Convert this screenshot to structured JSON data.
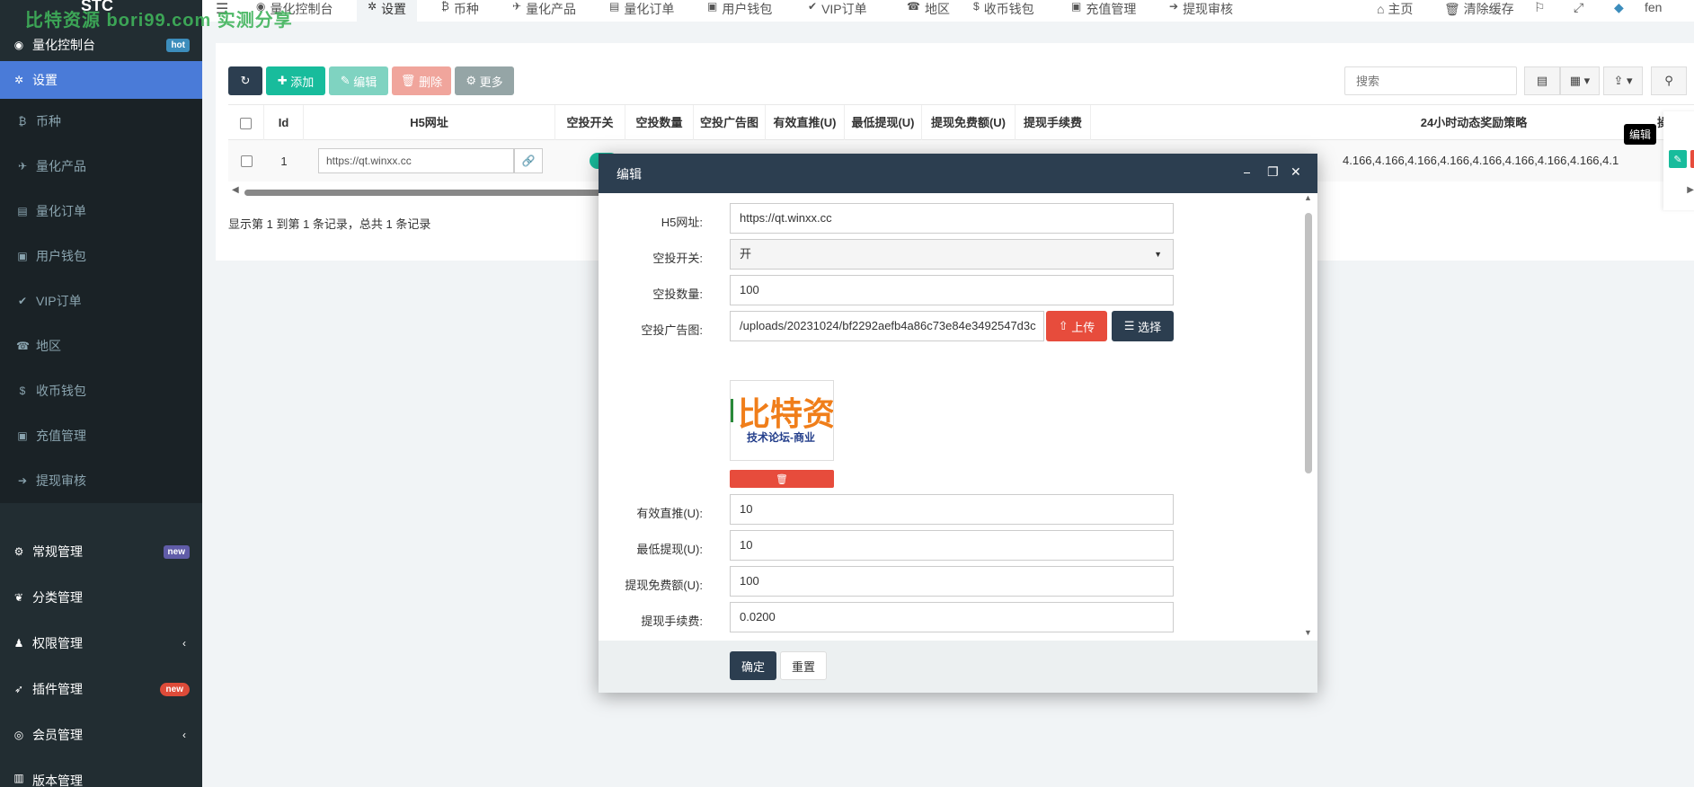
{
  "brand": {
    "name": "STC",
    "watermark": "比特资源  bori99.com  实测分享"
  },
  "sidebar": {
    "items": [
      {
        "label": "量化控制台",
        "icon": "dashboard-icon",
        "glyph": "◉",
        "badge": "hot"
      },
      {
        "label": "设置",
        "icon": "gear-icon",
        "glyph": "✲",
        "active": true
      },
      {
        "label": "币种",
        "icon": "bitcoin-icon",
        "glyph": "₿"
      },
      {
        "label": "量化产品",
        "icon": "plane-icon",
        "glyph": "✈"
      },
      {
        "label": "量化订单",
        "icon": "book-icon",
        "glyph": "▤"
      },
      {
        "label": "用户钱包",
        "icon": "money-icon",
        "glyph": "▣"
      },
      {
        "label": "VIP订单",
        "icon": "check-circle-icon",
        "glyph": "✔"
      },
      {
        "label": "地区",
        "icon": "phone-square-icon",
        "glyph": "☎"
      },
      {
        "label": "收币钱包",
        "icon": "dollar-icon",
        "glyph": "$"
      },
      {
        "label": "充值管理",
        "icon": "money-icon",
        "glyph": "▣"
      },
      {
        "label": "提现审核",
        "icon": "arrow-circle-icon",
        "glyph": "➔"
      },
      {
        "label": "常规管理",
        "icon": "cogs-icon",
        "glyph": "⚙",
        "badge": "new"
      },
      {
        "label": "分类管理",
        "icon": "leaf-icon",
        "glyph": "❦"
      },
      {
        "label": "权限管理",
        "icon": "group-icon",
        "glyph": "♟"
      },
      {
        "label": "插件管理",
        "icon": "rocket-icon",
        "glyph": "➶",
        "badge": "new"
      },
      {
        "label": "会员管理",
        "icon": "user-circle-icon",
        "glyph": "◎"
      },
      {
        "label": "版本管理",
        "icon": "file-icon",
        "glyph": "▥"
      }
    ]
  },
  "topbar": {
    "tabs": [
      {
        "label": "量化控制台",
        "icon": "dashboard-icon",
        "glyph": "◉"
      },
      {
        "label": "设置",
        "icon": "gear-icon",
        "glyph": "✲",
        "active": true
      },
      {
        "label": "币种",
        "icon": "bitcoin-icon",
        "glyph": "₿"
      },
      {
        "label": "量化产品",
        "icon": "plane-icon",
        "glyph": "✈"
      },
      {
        "label": "量化订单",
        "icon": "book-icon",
        "glyph": "▤"
      },
      {
        "label": "用户钱包",
        "icon": "money-icon",
        "glyph": "▣"
      },
      {
        "label": "VIP订单",
        "icon": "check-circle-icon",
        "glyph": "✔"
      },
      {
        "label": "地区",
        "icon": "phone-square-icon",
        "glyph": "☎"
      },
      {
        "label": "收币钱包",
        "icon": "dollar-icon",
        "glyph": "$"
      },
      {
        "label": "充值管理",
        "icon": "money-icon",
        "glyph": "▣"
      },
      {
        "label": "提现审核",
        "icon": "arrow-circle-icon",
        "glyph": "➔"
      }
    ],
    "home": "主页",
    "clear_cache": "清除缓存",
    "username": "fen"
  },
  "toolbar": {
    "add": "添加",
    "edit": "编辑",
    "delete": "删除",
    "more": "更多",
    "search_placeholder": "搜索"
  },
  "table": {
    "headers": [
      "Id",
      "H5网址",
      "空投开关",
      "空投数量",
      "空投广告图",
      "有效直推(U)",
      "最低提现(U)",
      "提现免费额(U)",
      "提现手续费",
      "24小时动态奖励策略",
      "操作"
    ],
    "row": {
      "id": "1",
      "h5_url": "https://qt.winxx.cc",
      "long_values": "4.166,4.166,4.166,4.166,4.166,4.166,4.166,4.166,4.1"
    },
    "tooltip": "编辑",
    "summary": "显示第 1 到第 1 条记录，总共 1 条记录"
  },
  "modal": {
    "title": "编辑",
    "fields": {
      "h5_label": "H5网址:",
      "h5_value": "https://qt.winxx.cc",
      "airdrop_switch_label": "空投开关:",
      "airdrop_switch_value": "开",
      "airdrop_amount_label": "空投数量:",
      "airdrop_amount_value": "100",
      "airdrop_image_label": "空投广告图:",
      "airdrop_image_value": "/uploads/20231024/bf2292aefb4a86c73e84e3492547d3c",
      "upload_label": "上传",
      "choose_label": "选择",
      "preview_big": "比特资",
      "preview_small": "技术论坛-商业",
      "direct_label": "有效直推(U):",
      "direct_value": "10",
      "min_withdraw_label": "最低提现(U):",
      "min_withdraw_value": "10",
      "free_quota_label": "提现免费额(U):",
      "free_quota_value": "100",
      "fee_label": "提现手续费:",
      "fee_value": "0.0200"
    },
    "confirm": "确定",
    "reset": "重置"
  },
  "colors": {
    "sidebar_bg": "#222d32",
    "active_blue": "#4a7bd8",
    "primary_dark": "#2c3e50",
    "success": "#18bc9c",
    "danger": "#e74c3c"
  }
}
